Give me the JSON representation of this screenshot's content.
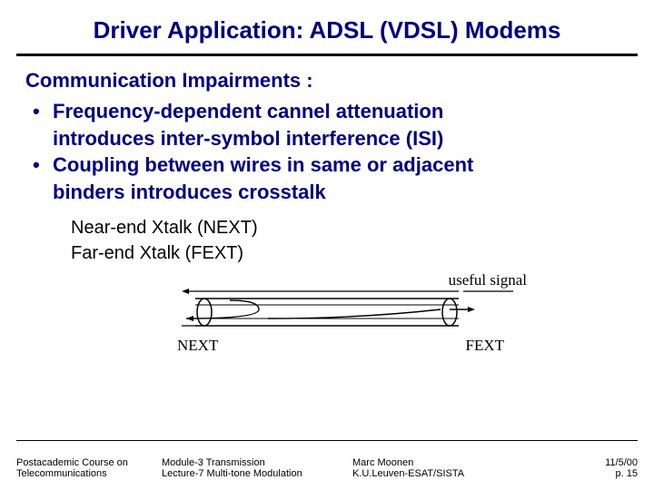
{
  "title": "Driver Application: ADSL (VDSL) Modems",
  "heading": "Communication Impairments :",
  "bullets": [
    {
      "line1": "Frequency-dependent cannel attenuation",
      "line2": "introduces inter-symbol interference (ISI)"
    },
    {
      "line1": "Coupling between wires in same or adjacent",
      "line2": "binders introduces crosstalk"
    }
  ],
  "xtalk": {
    "near": "Near-end Xtalk (NEXT)",
    "far": "Far-end Xtalk (FEXT)"
  },
  "diagram": {
    "useful": "useful signal",
    "next": "NEXT",
    "fext": "FEXT"
  },
  "footer": {
    "course1": "Postacademic Course on",
    "course2": "Telecommunications",
    "module": "Module-3  Transmission",
    "lecture": "Lecture-7  Multi-tone Modulation",
    "author": "Marc Moonen",
    "affil": "K.U.Leuven-ESAT/SISTA",
    "date": "11/5/00",
    "page": "p. 15"
  }
}
